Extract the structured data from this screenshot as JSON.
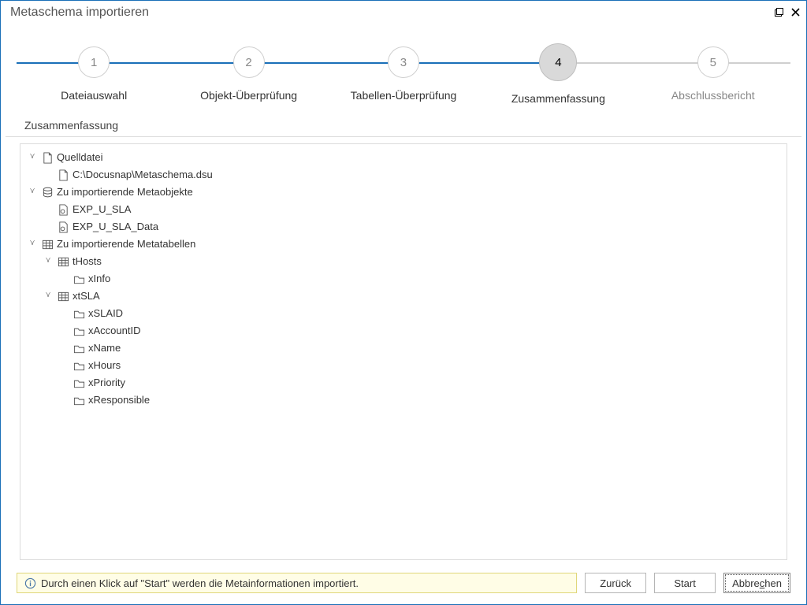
{
  "window": {
    "title": "Metaschema importieren"
  },
  "wizard": {
    "active_index": 3,
    "steps": [
      {
        "num": "1",
        "label": "Dateiauswahl"
      },
      {
        "num": "2",
        "label": "Objekt-Überprüfung"
      },
      {
        "num": "3",
        "label": "Tabellen-Überprüfung"
      },
      {
        "num": "4",
        "label": "Zusammenfassung"
      },
      {
        "num": "5",
        "label": "Abschlussbericht"
      }
    ]
  },
  "subheader": "Zusammenfassung",
  "tree": {
    "source_file": {
      "label": "Quelldatei",
      "path": "C:\\Docusnap\\Metaschema.dsu"
    },
    "meta_objects": {
      "label": "Zu importierende Metaobjekte",
      "items": [
        "EXP_U_SLA",
        "EXP_U_SLA_Data"
      ]
    },
    "meta_tables": {
      "label": "Zu importierende Metatabellen",
      "tables": [
        {
          "name": "tHosts",
          "fields": [
            "xInfo"
          ]
        },
        {
          "name": "xtSLA",
          "fields": [
            "xSLAID",
            "xAccountID",
            "xName",
            "xHours",
            "xPriority",
            "xResponsible"
          ]
        }
      ]
    }
  },
  "hint": "Durch einen Klick auf \"Start\" werden die Metainformationen importiert.",
  "buttons": {
    "back": "Zurück",
    "start": "Start",
    "cancel_pre": "Abbre",
    "cancel_accel": "c",
    "cancel_post": "hen"
  }
}
